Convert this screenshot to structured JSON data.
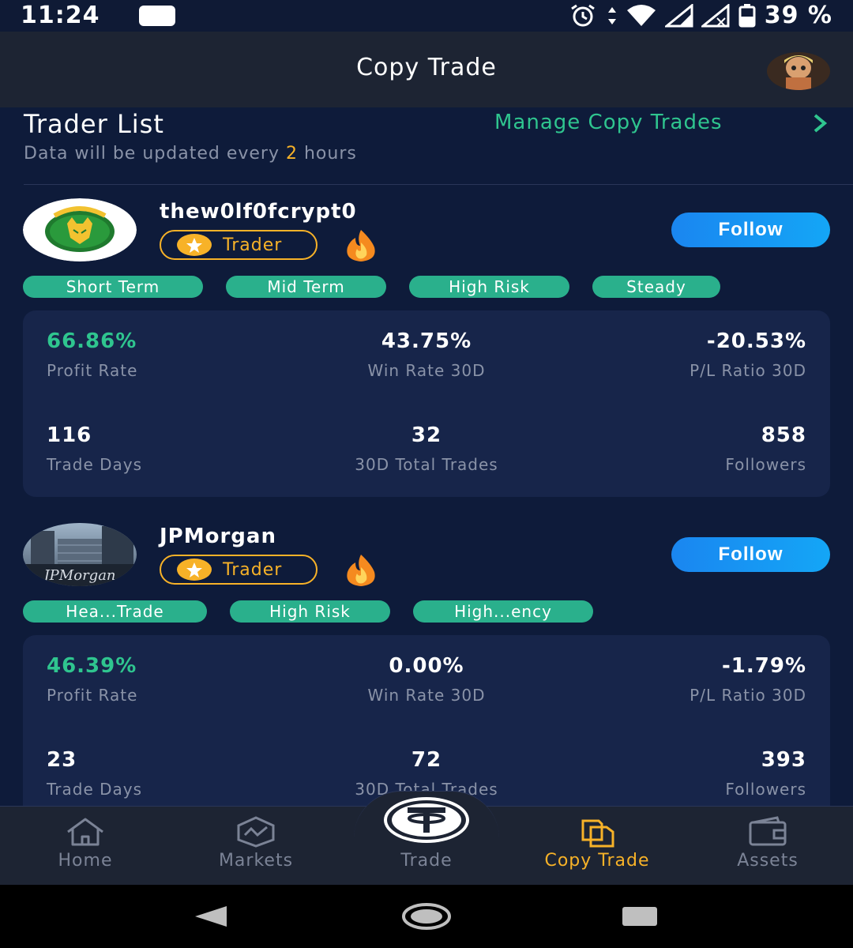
{
  "status_bar": {
    "time": "11:24",
    "battery_text": "39 %"
  },
  "header": {
    "title": "Copy Trade",
    "avatar_icon": "profile-avatar"
  },
  "trader_list": {
    "title": "Trader List",
    "manage_link": "Manage Copy Trades",
    "update_note_prefix": "Data will be updated every",
    "update_note_value": "2",
    "update_note_suffix": "hours"
  },
  "traders": [
    {
      "name": "thew0lf0fcrypt0",
      "badge": "Trader",
      "follow_label": "Follow",
      "tags": [
        "Short Term",
        "Mid Term",
        "High Risk",
        "Steady"
      ],
      "stats": {
        "profit_rate": {
          "value": "66.86%",
          "label": "Profit Rate"
        },
        "win_rate": {
          "value": "43.75%",
          "label": "Win Rate 30D"
        },
        "pl_ratio": {
          "value": "-20.53%",
          "label": "P/L Ratio 30D"
        },
        "trade_days": {
          "value": "116",
          "label": "Trade Days"
        },
        "total_trades": {
          "value": "32",
          "label": "30D Total Trades"
        },
        "followers": {
          "value": "858",
          "label": "Followers"
        }
      }
    },
    {
      "name": "JPMorgan",
      "badge": "Trader",
      "follow_label": "Follow",
      "tags": [
        "Hea...Trade",
        "High Risk",
        "High...ency"
      ],
      "stats": {
        "profit_rate": {
          "value": "46.39%",
          "label": "Profit Rate"
        },
        "win_rate": {
          "value": "0.00%",
          "label": "Win Rate 30D"
        },
        "pl_ratio": {
          "value": "-1.79%",
          "label": "P/L Ratio 30D"
        },
        "trade_days": {
          "value": "23",
          "label": "Trade Days"
        },
        "total_trades": {
          "value": "72",
          "label": "30D Total Trades"
        },
        "followers": {
          "value": "393",
          "label": "Followers"
        }
      }
    }
  ],
  "bottom_nav": {
    "items": [
      {
        "label": "Home",
        "icon": "home-icon"
      },
      {
        "label": "Markets",
        "icon": "markets-icon"
      },
      {
        "label": "Trade",
        "icon": "tether-icon"
      },
      {
        "label": "Copy Trade",
        "icon": "copy-trade-icon",
        "active": true
      },
      {
        "label": "Assets",
        "icon": "wallet-icon"
      }
    ]
  },
  "colors": {
    "background": "#0e1b3a",
    "accent_green": "#2fc58f",
    "accent_gold": "#f7b228",
    "follow_blue": "#1a86f0"
  }
}
